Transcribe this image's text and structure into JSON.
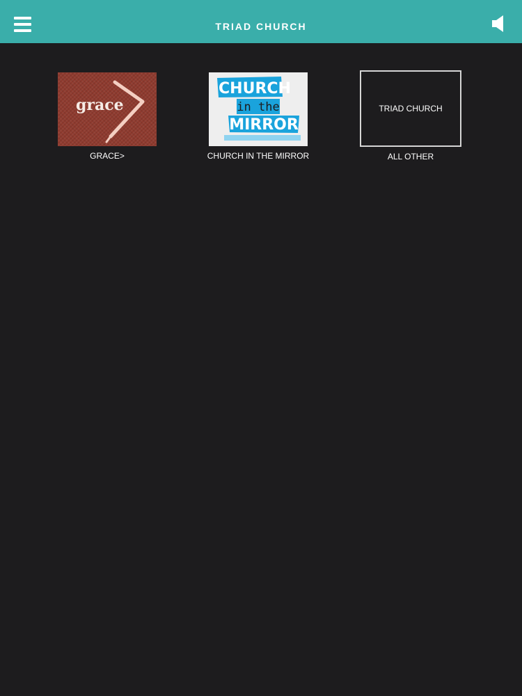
{
  "header": {
    "title": "TRIAD CHURCH",
    "menu_icon": "hamburger-menu-icon",
    "speaker_icon": "speaker-icon"
  },
  "colors": {
    "header_bg": "#3aaeaa",
    "page_bg": "#1d1c1e",
    "mirror_blue": "#1aa3dc"
  },
  "tiles": [
    {
      "caption": "GRACE>",
      "thumb_text": "grace"
    },
    {
      "caption": "CHURCH IN THE MIRROR",
      "thumb_lines": [
        "CHURCH",
        "in the",
        "MIRROR"
      ]
    },
    {
      "caption": "ALL OTHER",
      "thumb_text": "TRIAD CHURCH"
    }
  ]
}
